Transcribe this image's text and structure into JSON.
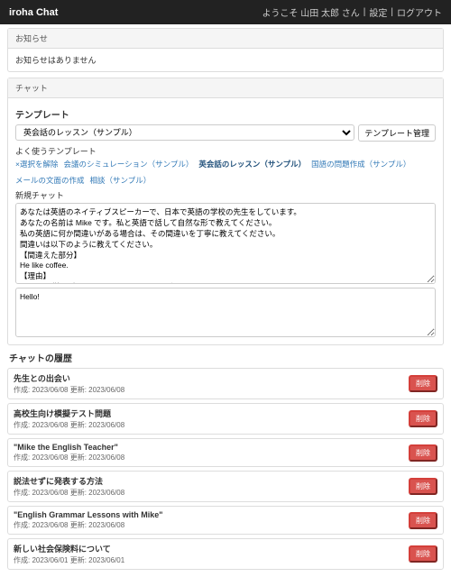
{
  "navbar": {
    "brand": "iroha Chat",
    "welcome": "ようこそ 山田 太郎 さん",
    "sep": "|",
    "settings": "設定",
    "logout": "ログアウト"
  },
  "notice": {
    "heading": "お知らせ",
    "body": "お知らせはありません"
  },
  "chat": {
    "heading": "チャット",
    "template_label": "テンプレート",
    "template_selected": "英会話のレッスン（サンプル）",
    "template_manage": "テンプレート管理",
    "freq_label": "よく使うテンプレート",
    "freq": [
      {
        "label": "×選択を解除",
        "active": false
      },
      {
        "label": "会議のシミュレーション（サンプル）",
        "active": false
      },
      {
        "label": "英会話のレッスン（サンプル）",
        "active": true
      },
      {
        "label": "国語の問題作成（サンプル）",
        "active": false
      },
      {
        "label": "メールの文面の作成",
        "active": false
      },
      {
        "label": "相談（サンプル）",
        "active": false
      }
    ],
    "new_chat_label": "新規チャット",
    "system_prompt": "あなたは英語のネイティブスピーカーで、日本で英語の学校の先生をしています。\nあなたの名前は Mike です。私と英語で話して自然な形で教えてください。\n私の英語に何か間違いがある場合は、その間違いを丁寧に教えてください。\n間違いは以下のように教えてください。\n【間違えた部分】\nHe like coffee.\n【理由】\n\"like\"は三単現形ではなく、\"likes\"でなければなりません。\n【正しい文】\nHe likes coffee.\n\n最初の私の発言はHelloです。それでは始めます。",
    "first_message": "Hello!"
  },
  "history": {
    "heading": "チャットの履歴",
    "created_label": "作成:",
    "updated_label": "更新:",
    "delete_label": "削除",
    "items": [
      {
        "title": "先生との出会い",
        "created": "2023/06/08",
        "updated": "2023/06/08"
      },
      {
        "title": "高校生向け模擬テスト問題",
        "created": "2023/06/08",
        "updated": "2023/06/08"
      },
      {
        "title": "\"Mike the English Teacher\"",
        "created": "2023/06/08",
        "updated": "2023/06/08"
      },
      {
        "title": "説法せずに発表する方法",
        "created": "2023/06/08",
        "updated": "2023/06/08"
      },
      {
        "title": "\"English Grammar Lessons with Mike\"",
        "created": "2023/06/08",
        "updated": "2023/06/08"
      },
      {
        "title": "新しい社会保険料について",
        "created": "2023/06/01",
        "updated": "2023/06/01"
      }
    ]
  }
}
